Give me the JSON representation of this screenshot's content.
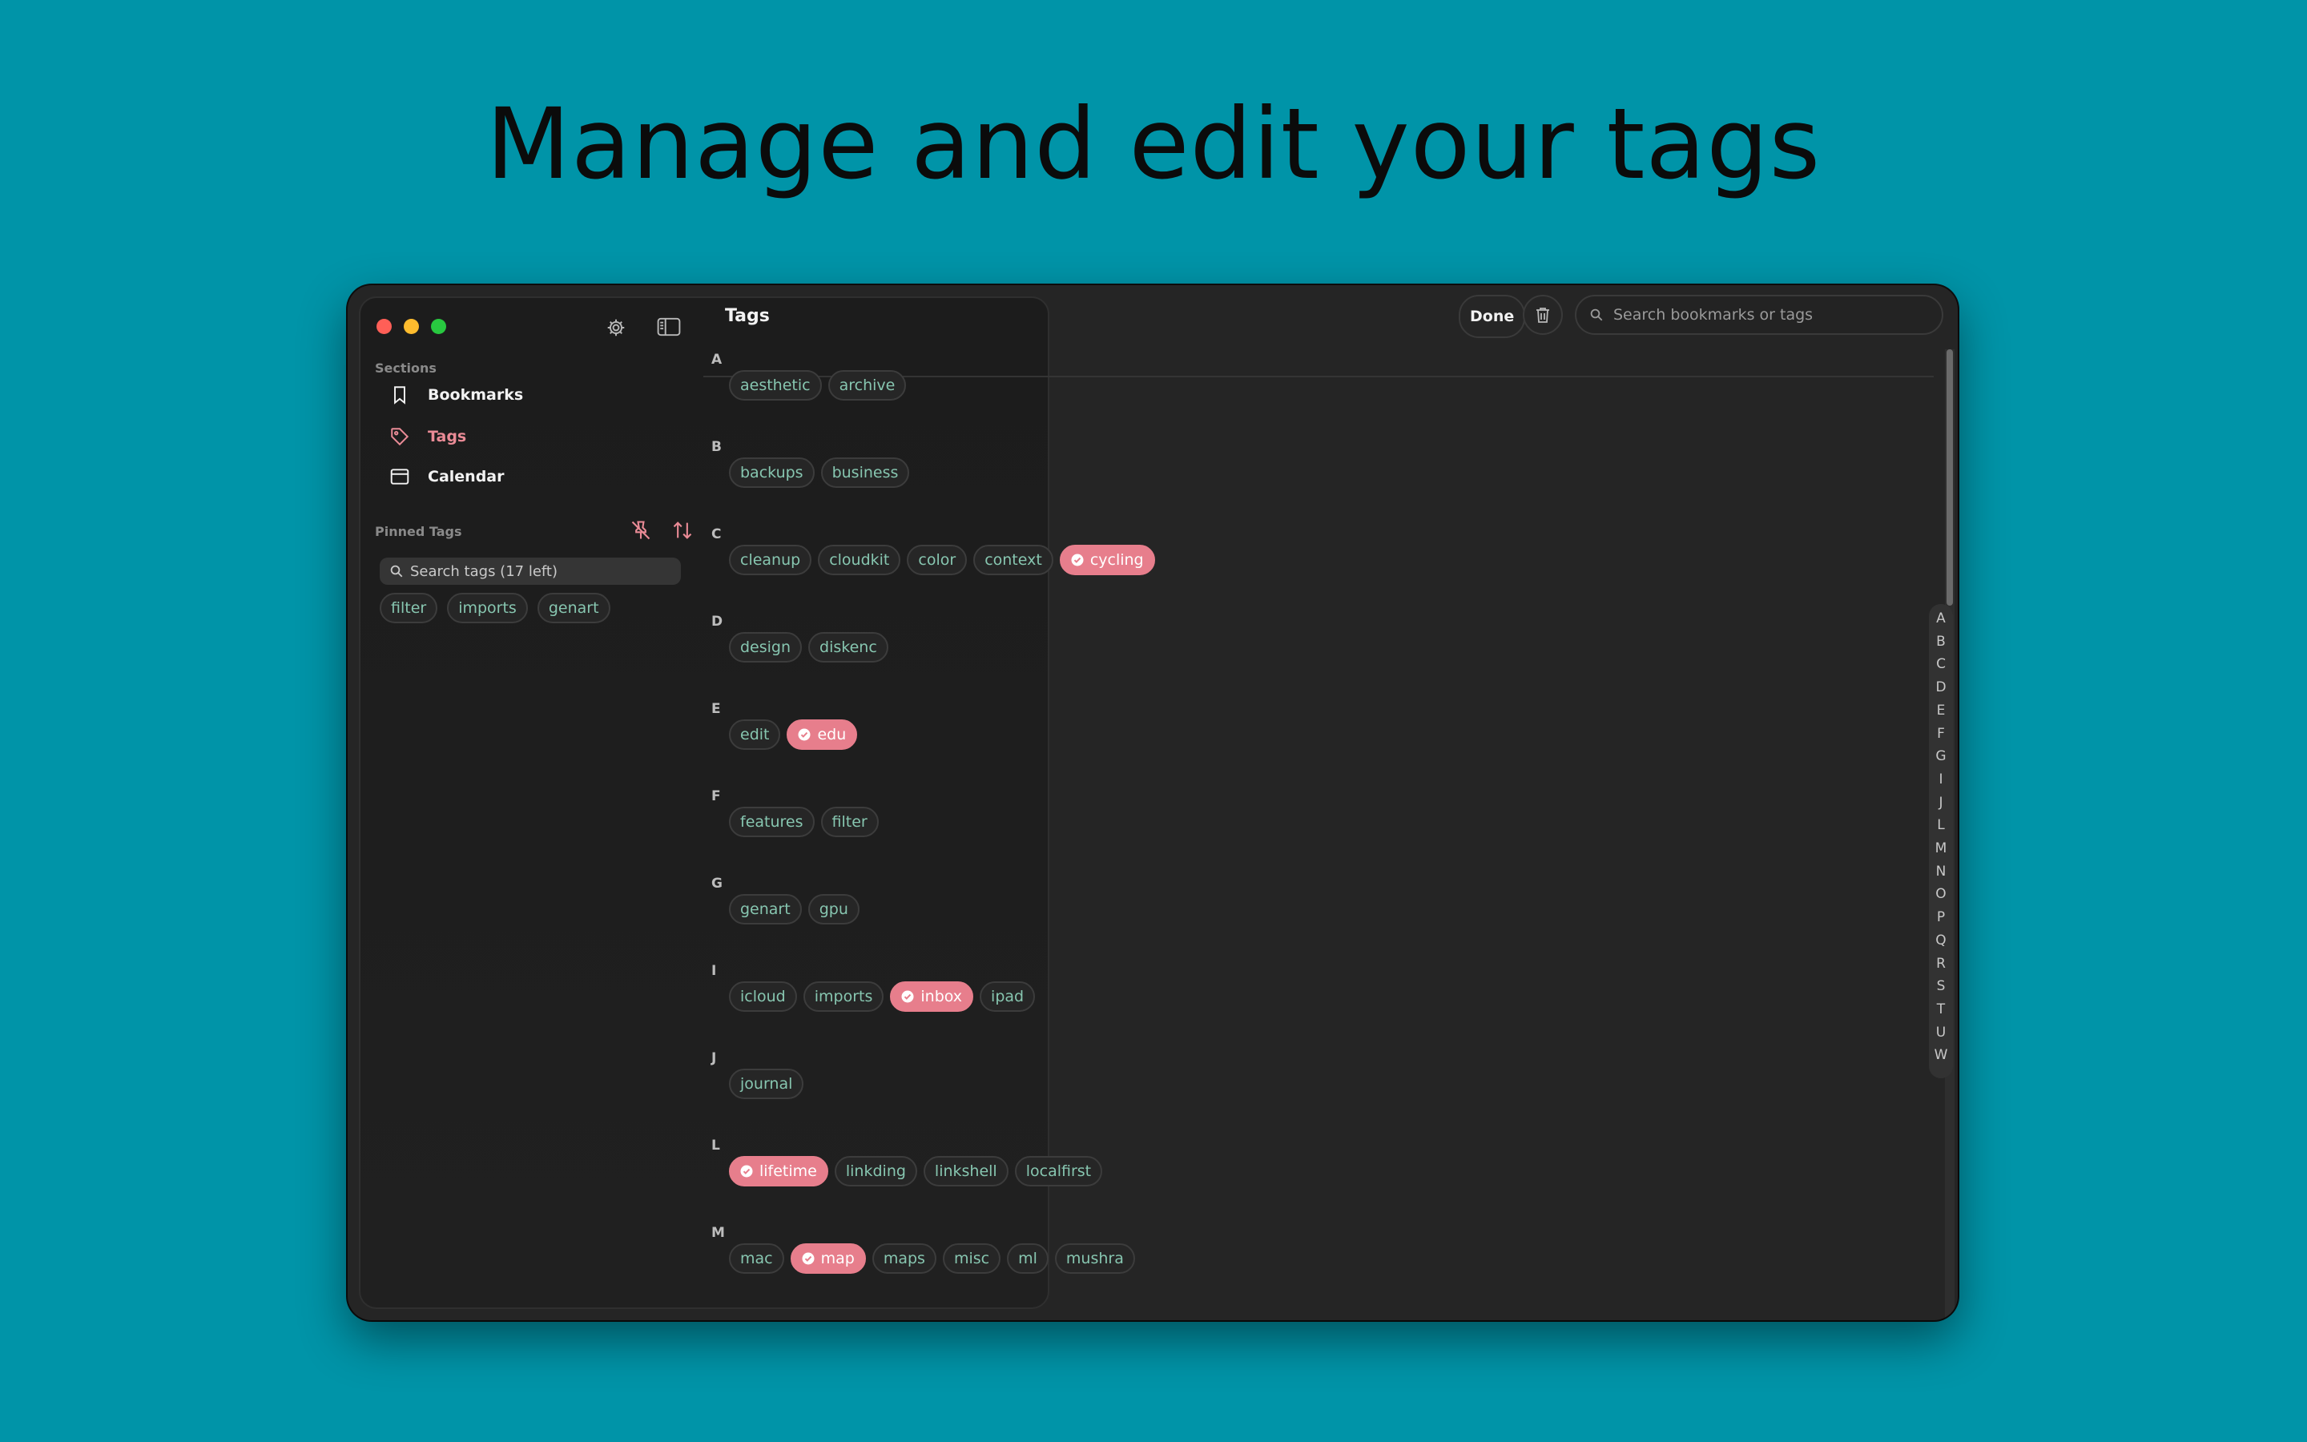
{
  "headline": "Manage and edit your tags",
  "colors": {
    "background": "#0094a8",
    "window": "#252525",
    "accent": "#e77e8c",
    "tag_text": "#87c6b0",
    "traffic_red": "#ff5f57",
    "traffic_yellow": "#febc2e",
    "traffic_green": "#28c840"
  },
  "sidebar": {
    "toolbar_icons": [
      "gear-icon",
      "sidebar-toggle-icon"
    ],
    "sections_title": "Sections",
    "items": [
      {
        "label": "Bookmarks",
        "icon": "bookmark-icon",
        "active": false
      },
      {
        "label": "Tags",
        "icon": "tag-icon",
        "active": true
      },
      {
        "label": "Calendar",
        "icon": "calendar-icon",
        "active": false
      }
    ],
    "pinned_title": "Pinned Tags",
    "pinned_actions": [
      "unpin-icon",
      "sort-icon"
    ],
    "search_placeholder": "Search tags (17 left)",
    "pinned_tags": [
      "filter",
      "imports",
      "genart"
    ]
  },
  "main": {
    "title": "Tags",
    "done_label": "Done",
    "search_placeholder": "Search bookmarks or tags",
    "groups": [
      {
        "letter": "A",
        "tags": [
          {
            "name": "aesthetic"
          },
          {
            "name": "archive"
          }
        ]
      },
      {
        "letter": "B",
        "tags": [
          {
            "name": "backups"
          },
          {
            "name": "business"
          }
        ]
      },
      {
        "letter": "C",
        "tags": [
          {
            "name": "cleanup"
          },
          {
            "name": "cloudkit"
          },
          {
            "name": "color"
          },
          {
            "name": "context"
          },
          {
            "name": "cycling",
            "selected": true
          }
        ]
      },
      {
        "letter": "D",
        "tags": [
          {
            "name": "design"
          },
          {
            "name": "diskenc"
          }
        ]
      },
      {
        "letter": "E",
        "tags": [
          {
            "name": "edit"
          },
          {
            "name": "edu",
            "selected": true
          }
        ]
      },
      {
        "letter": "F",
        "tags": [
          {
            "name": "features"
          },
          {
            "name": "filter"
          }
        ]
      },
      {
        "letter": "G",
        "tags": [
          {
            "name": "genart"
          },
          {
            "name": "gpu"
          }
        ]
      },
      {
        "letter": "I",
        "tags": [
          {
            "name": "icloud"
          },
          {
            "name": "imports"
          },
          {
            "name": "inbox",
            "selected": true
          },
          {
            "name": "ipad"
          }
        ]
      },
      {
        "letter": "J",
        "tags": [
          {
            "name": "journal"
          }
        ]
      },
      {
        "letter": "L",
        "tags": [
          {
            "name": "lifetime",
            "selected": true
          },
          {
            "name": "linkding"
          },
          {
            "name": "linkshell"
          },
          {
            "name": "localfirst"
          }
        ]
      },
      {
        "letter": "M",
        "tags": [
          {
            "name": "mac"
          },
          {
            "name": "map",
            "selected": true
          },
          {
            "name": "maps"
          },
          {
            "name": "misc"
          },
          {
            "name": "ml"
          },
          {
            "name": "mushra"
          }
        ]
      }
    ],
    "index_letters": [
      "A",
      "B",
      "C",
      "D",
      "E",
      "F",
      "G",
      "I",
      "J",
      "L",
      "M",
      "N",
      "O",
      "P",
      "Q",
      "R",
      "S",
      "T",
      "U",
      "W"
    ]
  }
}
